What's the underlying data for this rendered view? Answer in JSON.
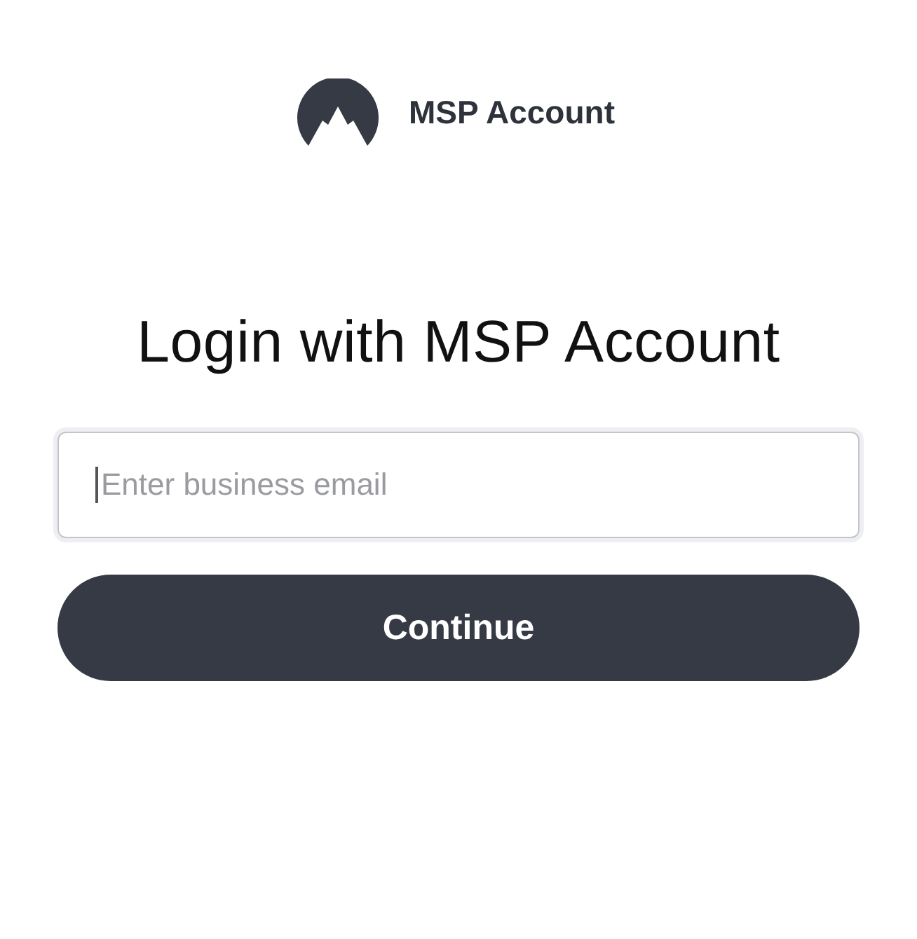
{
  "brand": {
    "name": "MSP Account"
  },
  "heading": "Login with MSP Account",
  "email_field": {
    "placeholder": "Enter business email",
    "focused": true
  },
  "buttons": [
    "Continue"
  ]
}
